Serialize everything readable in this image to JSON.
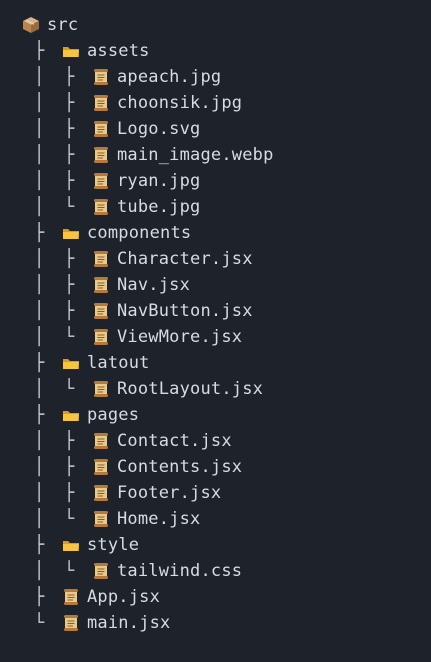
{
  "root": {
    "name": "src",
    "icon": "package-box-icon"
  },
  "items": [
    {
      "depth": 1,
      "type": "folder",
      "name": "assets",
      "branch": "├",
      "guides": []
    },
    {
      "depth": 2,
      "type": "file",
      "name": "apeach.jpg",
      "branch": "├",
      "guides": [
        "│"
      ]
    },
    {
      "depth": 2,
      "type": "file",
      "name": "choonsik.jpg",
      "branch": "├",
      "guides": [
        "│"
      ]
    },
    {
      "depth": 2,
      "type": "file",
      "name": "Logo.svg",
      "branch": "├",
      "guides": [
        "│"
      ]
    },
    {
      "depth": 2,
      "type": "file",
      "name": "main_image.webp",
      "branch": "├",
      "guides": [
        "│"
      ]
    },
    {
      "depth": 2,
      "type": "file",
      "name": "ryan.jpg",
      "branch": "├",
      "guides": [
        "│"
      ]
    },
    {
      "depth": 2,
      "type": "file",
      "name": "tube.jpg",
      "branch": "└",
      "guides": [
        "│"
      ]
    },
    {
      "depth": 1,
      "type": "folder",
      "name": "components",
      "branch": "├",
      "guides": []
    },
    {
      "depth": 2,
      "type": "file",
      "name": "Character.jsx",
      "branch": "├",
      "guides": [
        "│"
      ]
    },
    {
      "depth": 2,
      "type": "file",
      "name": "Nav.jsx",
      "branch": "├",
      "guides": [
        "│"
      ]
    },
    {
      "depth": 2,
      "type": "file",
      "name": "NavButton.jsx",
      "branch": "├",
      "guides": [
        "│"
      ]
    },
    {
      "depth": 2,
      "type": "file",
      "name": "ViewMore.jsx",
      "branch": "└",
      "guides": [
        "│"
      ]
    },
    {
      "depth": 1,
      "type": "folder",
      "name": "latout",
      "branch": "├",
      "guides": []
    },
    {
      "depth": 2,
      "type": "file",
      "name": "RootLayout.jsx",
      "branch": "└",
      "guides": [
        "│"
      ]
    },
    {
      "depth": 1,
      "type": "folder",
      "name": "pages",
      "branch": "├",
      "guides": []
    },
    {
      "depth": 2,
      "type": "file",
      "name": "Contact.jsx",
      "branch": "├",
      "guides": [
        "│"
      ]
    },
    {
      "depth": 2,
      "type": "file",
      "name": "Contents.jsx",
      "branch": "├",
      "guides": [
        "│"
      ]
    },
    {
      "depth": 2,
      "type": "file",
      "name": "Footer.jsx",
      "branch": "├",
      "guides": [
        "│"
      ]
    },
    {
      "depth": 2,
      "type": "file",
      "name": "Home.jsx",
      "branch": "└",
      "guides": [
        "│"
      ]
    },
    {
      "depth": 1,
      "type": "folder",
      "name": "style",
      "branch": "├",
      "guides": []
    },
    {
      "depth": 2,
      "type": "file",
      "name": "tailwind.css",
      "branch": "└",
      "guides": [
        "│"
      ]
    },
    {
      "depth": 1,
      "type": "file",
      "name": "App.jsx",
      "branch": "├",
      "guides": []
    },
    {
      "depth": 1,
      "type": "file",
      "name": "main.jsx",
      "branch": "└",
      "guides": []
    }
  ],
  "colors": {
    "background": "#1e222a",
    "text": "#d6dbe4",
    "folder": "#f5c542",
    "scroll": "#e9c98a",
    "scroll_dark": "#8a5a2b"
  }
}
